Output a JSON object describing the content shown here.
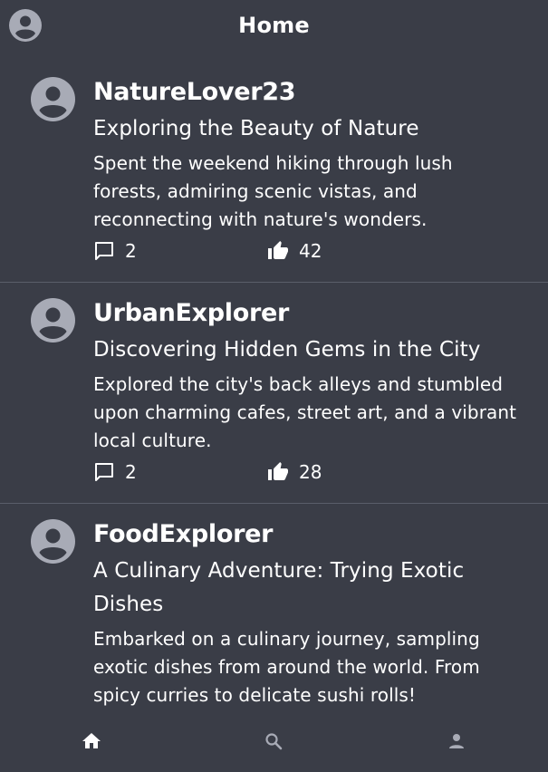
{
  "header": {
    "title": "Home",
    "avatar_icon": "account-circle-icon"
  },
  "posts": [
    {
      "username": "NatureLover23",
      "title": "Exploring the Beauty of Nature",
      "text": "Spent the weekend hiking through lush forests, admiring scenic vistas, and reconnecting with nature's wonders.",
      "comments": "2",
      "likes": "42"
    },
    {
      "username": "UrbanExplorer",
      "title": "Discovering Hidden Gems in the City",
      "text": "Explored the city's back alleys and stumbled upon charming cafes, street art, and a vibrant local culture.",
      "comments": "2",
      "likes": "28"
    },
    {
      "username": "FoodExplorer",
      "title": "A Culinary Adventure: Trying Exotic Dishes",
      "text": "Embarked on a culinary journey, sampling exotic dishes from around the world. From spicy curries to delicate sushi rolls!",
      "comments": "",
      "likes": ""
    }
  ],
  "bottom_nav": {
    "items": [
      "home-icon",
      "search-icon",
      "person-icon"
    ],
    "active": "home-icon"
  },
  "colors": {
    "background": "#3a3d47",
    "text": "#ffffff",
    "avatar": "#a8abb6",
    "divider": "#5a5e6a"
  }
}
